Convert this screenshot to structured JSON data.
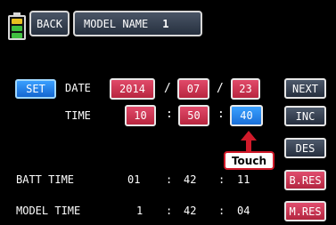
{
  "header": {
    "back_label": "BACK",
    "model_name_label": "MODEL NAME",
    "model_number": "1"
  },
  "battery": {
    "icon": "battery-icon",
    "level_colors": [
      "#e8c020",
      "#40c040",
      "#40c040"
    ]
  },
  "set_label": "SET",
  "date": {
    "label": "DATE",
    "year": "2014",
    "month": "07",
    "day": "23",
    "separator": "/"
  },
  "time": {
    "label": "TIME",
    "hour": "10",
    "minute": "50",
    "second": "40",
    "separator": ":"
  },
  "batt_time": {
    "label": "BATT TIME",
    "h": "01",
    "m": "42",
    "s": "11"
  },
  "model_time": {
    "label": "MODEL TIME",
    "h": "1",
    "m": "42",
    "s": "04"
  },
  "buttons": {
    "next": "NEXT",
    "inc": "INC",
    "des": "DES",
    "b_res": "B.RES",
    "m_res": "M.RES"
  },
  "annotation": {
    "touch_label": "Touch"
  },
  "colors": {
    "value_box": "#c8304e",
    "selected_box": "#2a86f0",
    "annotation_red": "#d11a2a"
  }
}
